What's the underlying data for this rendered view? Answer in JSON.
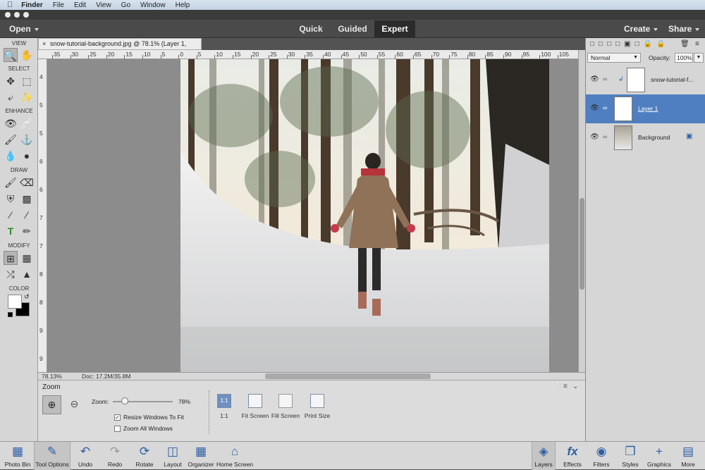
{
  "macbar": {
    "app": "Finder",
    "menus": [
      "File",
      "Edit",
      "View",
      "Go",
      "Window",
      "Help"
    ]
  },
  "appbar": {
    "open": "Open",
    "modes": [
      "Quick",
      "Guided",
      "Expert"
    ],
    "create": "Create",
    "share": "Share"
  },
  "toolbox": {
    "sections": [
      "VIEW",
      "SELECT",
      "ENHANCE",
      "DRAW",
      "MODIFY",
      "COLOR"
    ]
  },
  "document": {
    "tab_title": "snow-tutorial-background.jpg @ 78.1% (Layer 1, RGB/8) *",
    "ruler_top": [
      "35",
      "30",
      "25",
      "20",
      "15",
      "10",
      "5",
      "0",
      "5",
      "10",
      "15",
      "20",
      "25",
      "30",
      "35",
      "40",
      "45",
      "50",
      "55",
      "60",
      "65",
      "70",
      "75",
      "80",
      "85",
      "90",
      "95",
      "100",
      "105"
    ],
    "ruler_left": [
      "4",
      "5",
      "5",
      "6",
      "6",
      "7",
      "7",
      "8",
      "8",
      "9",
      "9"
    ],
    "zoom_pct": "78.13%",
    "doc_size": "Doc: 17.2M/35.8M"
  },
  "options": {
    "title": "Zoom",
    "zoom_label": "Zoom:",
    "zoom_value": "78%",
    "zoom_level": 0.2,
    "resize_label": "Resize Windows To Fit",
    "zoom_all_label": "Zoom All Windows",
    "btn_11": "1:1",
    "lbl_11": "1:1",
    "lbl_fit": "Fit Screen",
    "lbl_fill": "Fill Screen",
    "lbl_print": "Print Size"
  },
  "layers_panel": {
    "blend_mode": "Normal",
    "opacity_label": "Opacity:",
    "opacity_value": "100%",
    "layers": [
      {
        "name": "snow-tutorial-f..."
      },
      {
        "name": "Layer 1"
      },
      {
        "name": "Background"
      }
    ]
  },
  "bottombar": {
    "left": [
      "Photo Bin",
      "Tool Options",
      "Undo",
      "Redo",
      "Rotate",
      "Layout",
      "Organizer",
      "Home Screen"
    ],
    "right": [
      "Layers",
      "Effects",
      "Filters",
      "Styles",
      "Graphics",
      "More"
    ]
  }
}
